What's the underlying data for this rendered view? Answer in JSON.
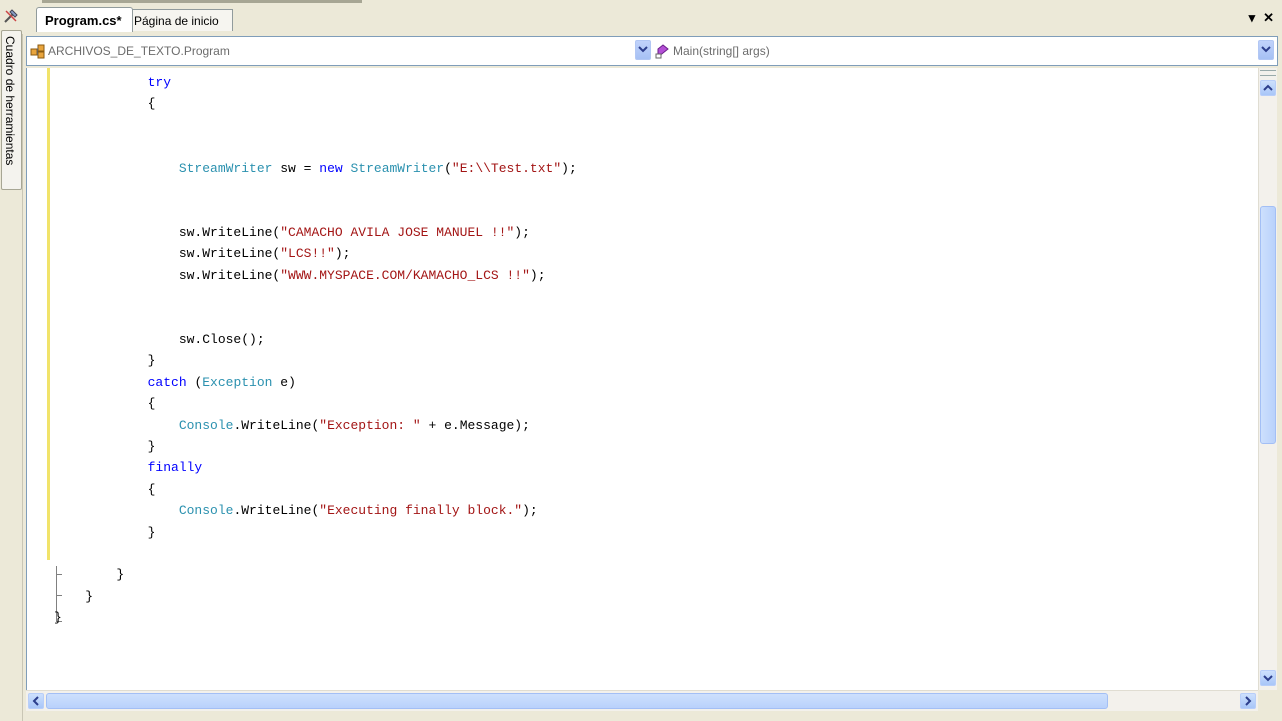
{
  "toolbox": {
    "label": "Cuadro de herramientas"
  },
  "tabs": [
    {
      "label": "Program.cs*",
      "active": true
    },
    {
      "label": "Página de inicio",
      "active": false
    }
  ],
  "tab_controls": {
    "dropdown": "▾",
    "close": "✕"
  },
  "navbar": {
    "type_selector": "ARCHIVOS_DE_TEXTO.Program",
    "member_selector": "Main(string[] args)"
  },
  "code_lines": [
    "            try",
    "            {",
    "",
    "",
    "                StreamWriter sw = new StreamWriter(\"E:\\\\Test.txt\");",
    "",
    "",
    "                sw.WriteLine(\"CAMACHO AVILA JOSE MANUEL !!\");",
    "                sw.WriteLine(\"LCS!!\");",
    "                sw.WriteLine(\"WWW.MYSPACE.COM/KAMACHO_LCS !!\");",
    "",
    "",
    "                sw.Close();",
    "            }",
    "            catch (Exception e)",
    "            {",
    "                Console.WriteLine(\"Exception: \" + e.Message);",
    "            }",
    "            finally",
    "            {",
    "                Console.WriteLine(\"Executing finally block.\");",
    "            }",
    "",
    "        }",
    "    }",
    "}"
  ],
  "colors": {
    "keyword": "#0000ff",
    "type": "#2b91af",
    "string": "#a31515",
    "changebar": "#f1e36a"
  },
  "icons": {
    "toolbox": "toolbox-icon",
    "class": "class-icon",
    "method": "method-icon"
  }
}
